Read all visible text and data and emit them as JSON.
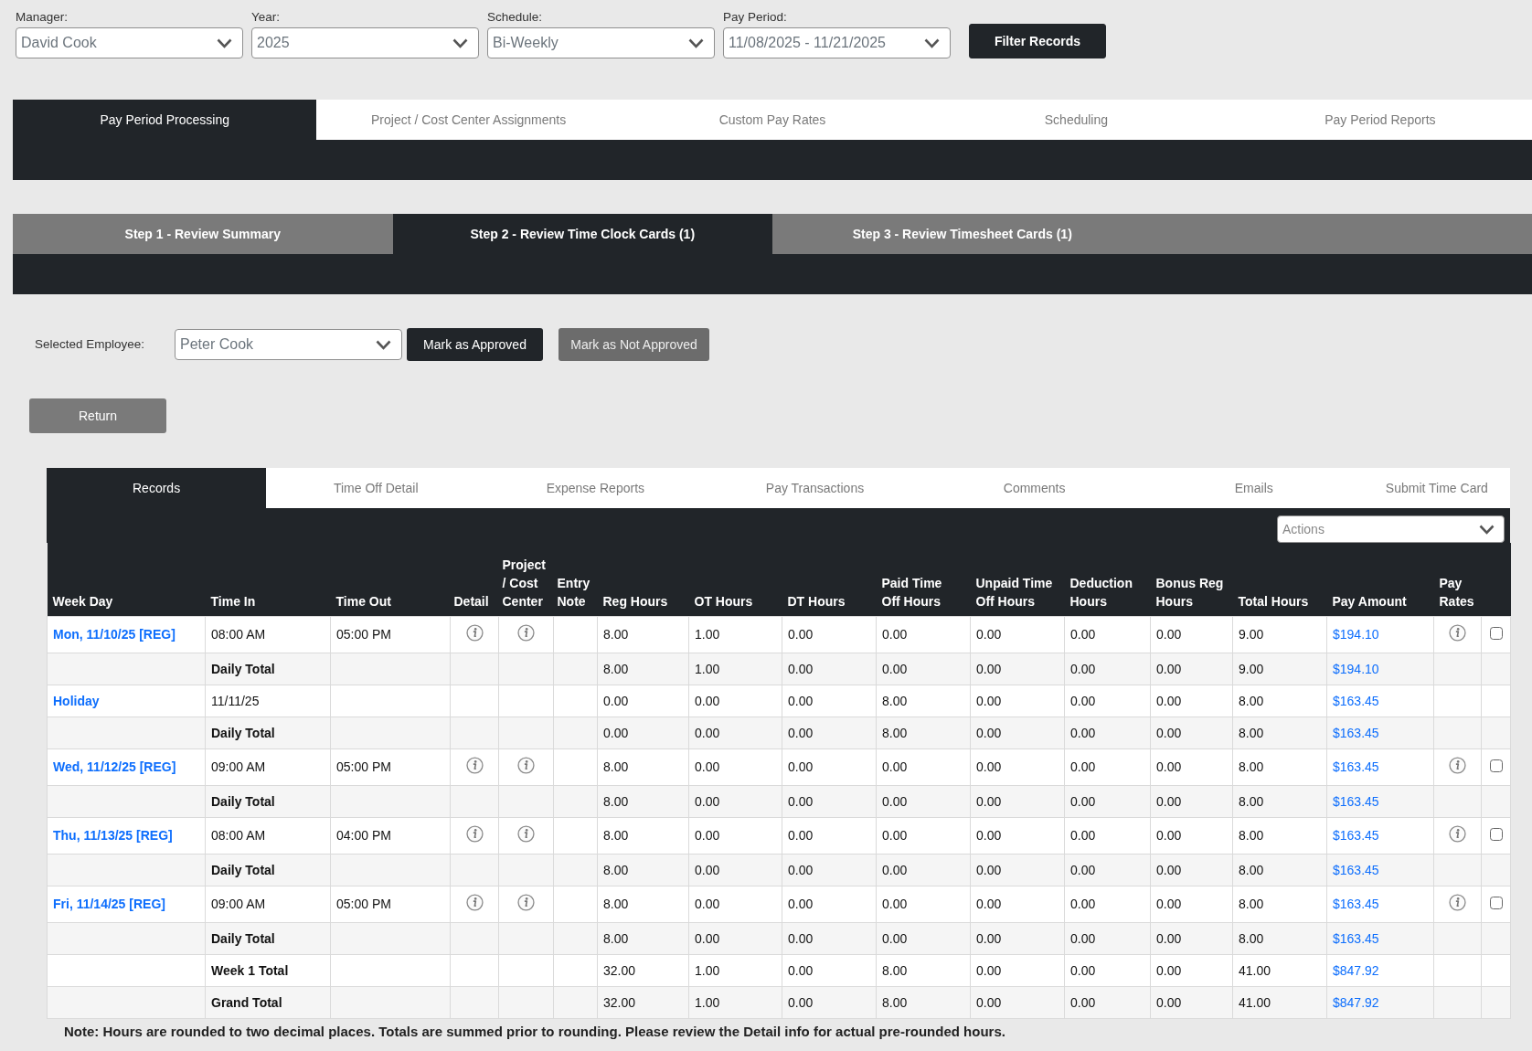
{
  "filters": [
    {
      "label": "Manager:",
      "value": "David Cook"
    },
    {
      "label": "Year:",
      "value": "2025"
    },
    {
      "label": "Schedule:",
      "value": "Bi-Weekly"
    },
    {
      "label": "Pay Period:",
      "value": "11/08/2025 - 11/21/2025"
    }
  ],
  "filter_button": "Filter Records",
  "main_tabs": [
    {
      "label": "Pay Period Processing",
      "selected": true
    },
    {
      "label": "Project / Cost Center Assignments",
      "selected": false
    },
    {
      "label": "Custom Pay Rates",
      "selected": false
    },
    {
      "label": "Scheduling",
      "selected": false
    },
    {
      "label": "Pay Period Reports",
      "selected": false
    }
  ],
  "step_tabs": [
    {
      "label": "Step 1 - Review Summary",
      "selected": false
    },
    {
      "label": "Step 2 - Review Time Clock Cards (1)",
      "selected": true
    },
    {
      "label": "Step 3 - Review Timesheet Cards (1)",
      "selected": false
    }
  ],
  "employee_picker": {
    "label": "Selected Employee:",
    "value": "Peter Cook"
  },
  "approval_buttons": [
    {
      "label": "Mark as Approved",
      "kind": "primary"
    },
    {
      "label": "Mark as Not Approved",
      "kind": "secondary"
    }
  ],
  "return_button": "Return",
  "record_tabs": [
    {
      "label": "Records",
      "selected": true
    },
    {
      "label": "Time Off Detail",
      "selected": false
    },
    {
      "label": "Expense Reports",
      "selected": false
    },
    {
      "label": "Pay Transactions",
      "selected": false
    },
    {
      "label": "Comments",
      "selected": false
    },
    {
      "label": "Emails",
      "selected": false
    },
    {
      "label": "Submit Time Card",
      "selected": false
    }
  ],
  "actions_select": {
    "placeholder": "Actions"
  },
  "table": {
    "columns": [
      "Week Day",
      "Time In",
      "Time Out",
      "Detail",
      "Project / Cost Center",
      "Entry Note",
      "Reg Hours",
      "OT Hours",
      "DT Hours",
      "Paid Time Off Hours",
      "Unpaid Time Off Hours",
      "Deduction Hours",
      "Bonus Reg Hours",
      "Total Hours",
      "Pay Amount",
      "Pay Rates"
    ],
    "rows": [
      {
        "kind": "entry",
        "day": "Mon, 11/10/25 [REG]",
        "time_in": "08:00 AM",
        "time_out": "05:00 PM",
        "hours": [
          "8.00",
          "1.00",
          "0.00",
          "0.00",
          "0.00",
          "0.00",
          "0.00",
          "9.00"
        ],
        "pay": "$194.10",
        "checked": false
      },
      {
        "kind": "total",
        "label": "Daily Total",
        "hours": [
          "8.00",
          "1.00",
          "0.00",
          "0.00",
          "0.00",
          "0.00",
          "0.00",
          "9.00"
        ],
        "pay": "$194.10"
      },
      {
        "kind": "holiday",
        "day": "Holiday",
        "time_in": "11/11/25",
        "hours": [
          "0.00",
          "0.00",
          "0.00",
          "8.00",
          "0.00",
          "0.00",
          "0.00",
          "8.00"
        ],
        "pay": "$163.45"
      },
      {
        "kind": "total",
        "label": "Daily Total",
        "hours": [
          "0.00",
          "0.00",
          "0.00",
          "8.00",
          "0.00",
          "0.00",
          "0.00",
          "8.00"
        ],
        "pay": "$163.45"
      },
      {
        "kind": "entry",
        "day": "Wed, 11/12/25 [REG]",
        "time_in": "09:00 AM",
        "time_out": "05:00 PM",
        "hours": [
          "8.00",
          "0.00",
          "0.00",
          "0.00",
          "0.00",
          "0.00",
          "0.00",
          "8.00"
        ],
        "pay": "$163.45",
        "checked": false
      },
      {
        "kind": "total",
        "label": "Daily Total",
        "hours": [
          "8.00",
          "0.00",
          "0.00",
          "0.00",
          "0.00",
          "0.00",
          "0.00",
          "8.00"
        ],
        "pay": "$163.45"
      },
      {
        "kind": "entry",
        "day": "Thu, 11/13/25 [REG]",
        "time_in": "08:00 AM",
        "time_out": "04:00 PM",
        "hours": [
          "8.00",
          "0.00",
          "0.00",
          "0.00",
          "0.00",
          "0.00",
          "0.00",
          "8.00"
        ],
        "pay": "$163.45",
        "checked": false
      },
      {
        "kind": "total",
        "label": "Daily Total",
        "hours": [
          "8.00",
          "0.00",
          "0.00",
          "0.00",
          "0.00",
          "0.00",
          "0.00",
          "8.00"
        ],
        "pay": "$163.45"
      },
      {
        "kind": "entry",
        "day": "Fri, 11/14/25 [REG]",
        "time_in": "09:00 AM",
        "time_out": "05:00 PM",
        "hours": [
          "8.00",
          "0.00",
          "0.00",
          "0.00",
          "0.00",
          "0.00",
          "0.00",
          "8.00"
        ],
        "pay": "$163.45",
        "checked": false
      },
      {
        "kind": "total",
        "label": "Daily Total",
        "hours": [
          "8.00",
          "0.00",
          "0.00",
          "0.00",
          "0.00",
          "0.00",
          "0.00",
          "8.00"
        ],
        "pay": "$163.45"
      },
      {
        "kind": "total",
        "label": "Week 1 Total",
        "hours": [
          "32.00",
          "1.00",
          "0.00",
          "8.00",
          "0.00",
          "0.00",
          "0.00",
          "41.00"
        ],
        "pay": "$847.92"
      },
      {
        "kind": "total",
        "label": "Grand Total",
        "hours": [
          "32.00",
          "1.00",
          "0.00",
          "8.00",
          "0.00",
          "0.00",
          "0.00",
          "41.00"
        ],
        "pay": "$847.92"
      }
    ]
  },
  "note": "Note: Hours are rounded to two decimal places. Totals are summed prior to rounding. Please review the Detail info for actual pre-rounded hours."
}
